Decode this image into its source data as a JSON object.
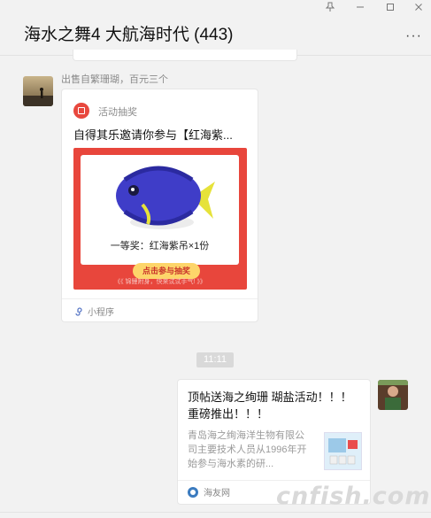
{
  "window": {
    "title": "海水之舞4 大航海时代 (443)",
    "pin_icon": "pin-icon",
    "minimize_icon": "minimize-icon",
    "maximize_icon": "maximize-icon",
    "close_icon": "close-icon",
    "more_label": "···"
  },
  "messages": {
    "incoming": {
      "sender": "出售自繁珊瑚，百元三个",
      "mini_program": {
        "source": "活动抽奖",
        "title": "自得其乐邀请你参与【红海紫...",
        "prize": "一等奖：红海紫吊×1份",
        "button": "点击参与抽奖",
        "footer_hint": "《《 锦鲤附身，快来试试手气! 》》",
        "type_label": "小程序"
      }
    },
    "timestamp": "11:11",
    "outgoing": {
      "link_card": {
        "title": "顶帖送海之绚珊 瑚盐活动！！！重磅推出！！！",
        "description": "青岛海之绚海洋生物有限公司主要技术人员从1996年开始参与海水素的研...",
        "site": "海友网"
      }
    }
  },
  "watermark": "cnfish.com",
  "colors": {
    "poster_red": "#e8463c",
    "button_yellow": "#fdd56a",
    "fish_blue": "#3f3dc8",
    "fish_yellow": "#e6e23a"
  }
}
